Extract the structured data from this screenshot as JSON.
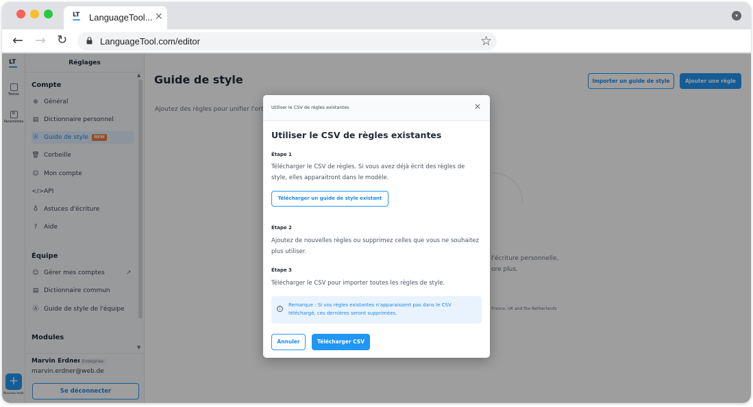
{
  "browser": {
    "tab_title": "LanguageTool...",
    "tab_logo": "LT",
    "url": "LanguageTool.com/editor",
    "icons": [
      "back-arrow-icon",
      "forward-arrow-icon",
      "reload-icon",
      "lock-icon",
      "star-icon",
      "close-icon"
    ]
  },
  "rail": {
    "logo": "LT",
    "items": [
      {
        "label": "Textes"
      },
      {
        "label": "Paramètres"
      }
    ],
    "new_text_label": "Nouveau texte"
  },
  "sidebar": {
    "header": "Réglages",
    "section_compte": "Compte",
    "compte_items": [
      {
        "label": "Général",
        "icon": "globe-icon"
      },
      {
        "label": "Dictionnaire personnel",
        "icon": "book-icon"
      },
      {
        "label": "Guide de style",
        "icon": "style-guide-icon",
        "badge": "NEW"
      },
      {
        "label": "Corbeille",
        "icon": "trash-icon"
      },
      {
        "label": "Mon compte",
        "icon": "user-icon"
      },
      {
        "label": "API",
        "icon": "code-icon"
      },
      {
        "label": "Astuces d'écriture",
        "icon": "lightbulb-icon"
      },
      {
        "label": "Aide",
        "icon": "help-icon"
      }
    ],
    "section_equipe": "Équipe",
    "equipe_items": [
      {
        "label": "Gérer mes comptes",
        "icon": "users-icon"
      },
      {
        "label": "Dictionnaire commun",
        "icon": "book-icon"
      },
      {
        "label": "Guide de style de l'équipe",
        "icon": "style-guide-icon"
      }
    ],
    "section_modules": "Modules",
    "user": {
      "name": "Marvin Erdner",
      "plan": "Enterprise",
      "email": "marvin.erdner@web.de"
    },
    "logout_label": "Se déconnecter"
  },
  "main": {
    "title": "Guide de style",
    "import_button": "Importer un guide de style",
    "add_rule_button": "Ajouter une règle",
    "description": "Ajoutez des règles pour unifier l'ortho",
    "bg_text_1": "l'écriture personnelle,",
    "bg_text_2": "ore plus.",
    "bg_text_3": "France, UK and the Netherlands"
  },
  "modal": {
    "bar_title": "Utiliser le CSV de règles existantes",
    "heading": "Utiliser le CSV de règles existantes",
    "step1_title": "Étape 1",
    "step1_text": "Télécharger le CSV de règles. Si vous avez déjà écrit des règles de style, elles apparaitront dans le modèle.",
    "step1_button": "Télécharger un guide de style existant",
    "step2_title": "Étape 2",
    "step2_text": "Ajoutez de nouvelles règles ou supprimez celles que vous ne souhaitez plus utiliser.",
    "step3_title": "Étape 3",
    "step3_text": "Télécharger le CSV pour importer toutes les règles de style.",
    "note": "Remarque : Si vos règles existantes n'apparaissent pas dans le CSV téléchargé, ces dernières seront supprimées.",
    "cancel_button": "Annuler",
    "download_button": "Télécharger CSV"
  }
}
